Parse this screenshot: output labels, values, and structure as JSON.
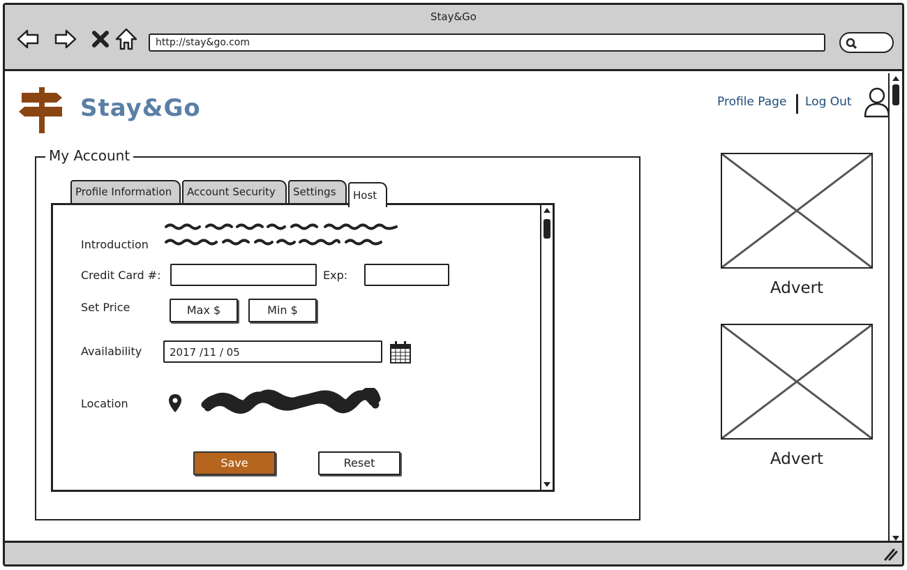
{
  "browser": {
    "title": "Stay&Go",
    "url": "http://stay&go.com"
  },
  "site": {
    "name": "Stay&Go",
    "links": {
      "profile": "Profile Page",
      "logout": "Log Out"
    }
  },
  "account": {
    "legend": "My Account",
    "tabs": [
      {
        "label": "Profile Information",
        "active": false
      },
      {
        "label": "Account Security",
        "active": false
      },
      {
        "label": "Settings",
        "active": false
      },
      {
        "label": "Host",
        "active": true
      }
    ],
    "form": {
      "introduction_label": "Introduction",
      "credit_card_label": "Credit Card #:",
      "credit_card_value": "",
      "exp_label": "Exp:",
      "exp_value": "",
      "set_price_label": "Set Price",
      "max_label": "Max $",
      "min_label": "Min $",
      "availability_label": "Availability",
      "availability_value": "2017  /11  / 05",
      "location_label": "Location",
      "save_label": "Save",
      "reset_label": "Reset"
    }
  },
  "adverts": [
    {
      "label": "Advert"
    },
    {
      "label": "Advert"
    }
  ],
  "colors": {
    "brand_text": "#5b7fa6",
    "link": "#1f4e79",
    "logo": "#8b4513",
    "save_button": "#b5651d",
    "chrome": "#cfcfcf"
  },
  "icons": [
    "back-icon",
    "forward-icon",
    "stop-icon",
    "home-icon",
    "search-icon",
    "signpost-logo-icon",
    "user-icon",
    "calendar-icon",
    "location-pin-icon",
    "resize-grip-icon"
  ]
}
